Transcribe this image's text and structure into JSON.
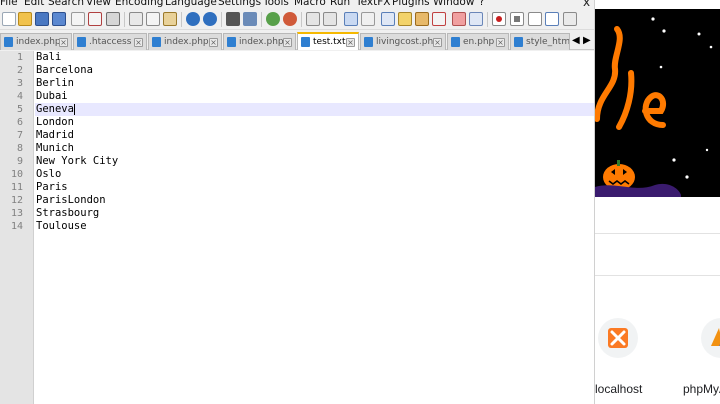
{
  "menu": {
    "items": [
      "File",
      "Edit",
      "Search",
      "View",
      "Encoding",
      "Language",
      "Settings",
      "Tools",
      "Macro",
      "Run",
      "TextFX",
      "Plugins",
      "Window",
      "?"
    ],
    "close_glyph": "x"
  },
  "tabs": [
    {
      "label": "index.php",
      "active": false
    },
    {
      "label": ".htaccess",
      "active": false
    },
    {
      "label": "index.php",
      "active": false
    },
    {
      "label": "index.php",
      "active": false
    },
    {
      "label": "test.txt",
      "active": true
    },
    {
      "label": "livingcost.php",
      "active": false
    },
    {
      "label": "en.php",
      "active": false
    },
    {
      "label": "style_html",
      "active": false
    }
  ],
  "tab_scroll": {
    "left": "◀",
    "right": "▶"
  },
  "editor": {
    "lines": [
      "Bali",
      "Barcelona",
      "Berlin",
      "Dubai",
      "Geneva",
      "London",
      "Madrid",
      "Munich",
      "New York City",
      "Oslo",
      "Paris",
      "ParisLondon",
      "Strasbourg",
      "Toulouse"
    ],
    "line_numbers": [
      "1",
      "2",
      "3",
      "4",
      "5",
      "6",
      "7",
      "8",
      "9",
      "10",
      "11",
      "12",
      "13",
      "14"
    ],
    "current_line": 5
  },
  "colors": {
    "active_tab_accent": "#f5b800",
    "current_line_highlight": "#e8e8ff",
    "halloween_orange": "#ff7a00",
    "halloween_purple": "#3a1b6e"
  },
  "browser_shortcuts": [
    {
      "label": "localhost",
      "icon": "xampp-icon"
    },
    {
      "label": "phpMyA",
      "icon": "phpmyadmin-icon"
    }
  ],
  "icons": {
    "toolbar": [
      "new-file-icon",
      "open-icon",
      "save-icon",
      "save-all-icon",
      "close-icon",
      "close-all-icon",
      "print-icon",
      "cut-icon",
      "copy-icon",
      "paste-icon",
      "undo-icon",
      "redo-icon",
      "find-icon",
      "replace-icon",
      "zoom-in-icon",
      "zoom-out-icon",
      "sync-v-icon",
      "sync-h-icon",
      "word-wrap-icon",
      "all-chars-icon",
      "indent-guide-icon",
      "udl-icon",
      "doc-map-icon",
      "function-list-icon",
      "folder-icon",
      "monitor-icon",
      "record-macro-icon",
      "stop-macro-icon",
      "play-macro-icon",
      "run-macro-multiple-icon",
      "save-macro-icon"
    ]
  }
}
